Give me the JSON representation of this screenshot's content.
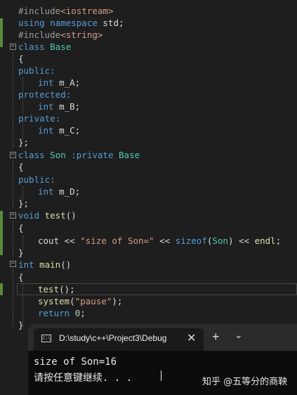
{
  "code": {
    "lines": [
      [
        "#include",
        "<iostream>"
      ],
      [
        "using namespace",
        " std;"
      ],
      [
        "#include",
        "<string>"
      ],
      [
        "class",
        " Base"
      ],
      [
        "{"
      ],
      [
        "public:"
      ],
      [
        "int",
        " m_A;"
      ],
      [
        "protected:"
      ],
      [
        "int",
        " m_B;"
      ],
      [
        "private:"
      ],
      [
        "int",
        " m_C;"
      ],
      [
        "};"
      ],
      [
        "class",
        " Son ",
        ":private",
        " Base"
      ],
      [
        "{"
      ],
      [
        "public:"
      ],
      [
        "int",
        " m_D;"
      ],
      [
        "};"
      ],
      [
        "void",
        " test",
        "()"
      ],
      [
        "{"
      ],
      [
        "cout << ",
        "\"size of Son=\"",
        " << ",
        "sizeof",
        "(",
        "Son",
        ") << ",
        "endl",
        ";"
      ],
      [
        "}"
      ],
      [
        "int",
        " main",
        "()"
      ],
      [
        "{"
      ],
      [
        "test",
        "();"
      ],
      [
        "system",
        "(",
        "\"pause\"",
        ");"
      ],
      [
        "return ",
        "0",
        ";"
      ],
      [
        "}"
      ]
    ]
  },
  "terminal": {
    "tab_title": "D:\\study\\c++\\Project3\\Debug",
    "tab_icon": "C:\\",
    "close": "✕",
    "new_tab": "+",
    "dropdown": "⌄",
    "output_line1": "size of Son=16",
    "output_line2": "请按任意键继续. . .",
    "watermark": "知乎 @五等分的商鞅"
  },
  "colors": {
    "keyword": "#569cd6",
    "type": "#4ec9b0",
    "string": "#d69d85",
    "background": "#1e1e1e",
    "change_bar": "#5a8a3a"
  }
}
